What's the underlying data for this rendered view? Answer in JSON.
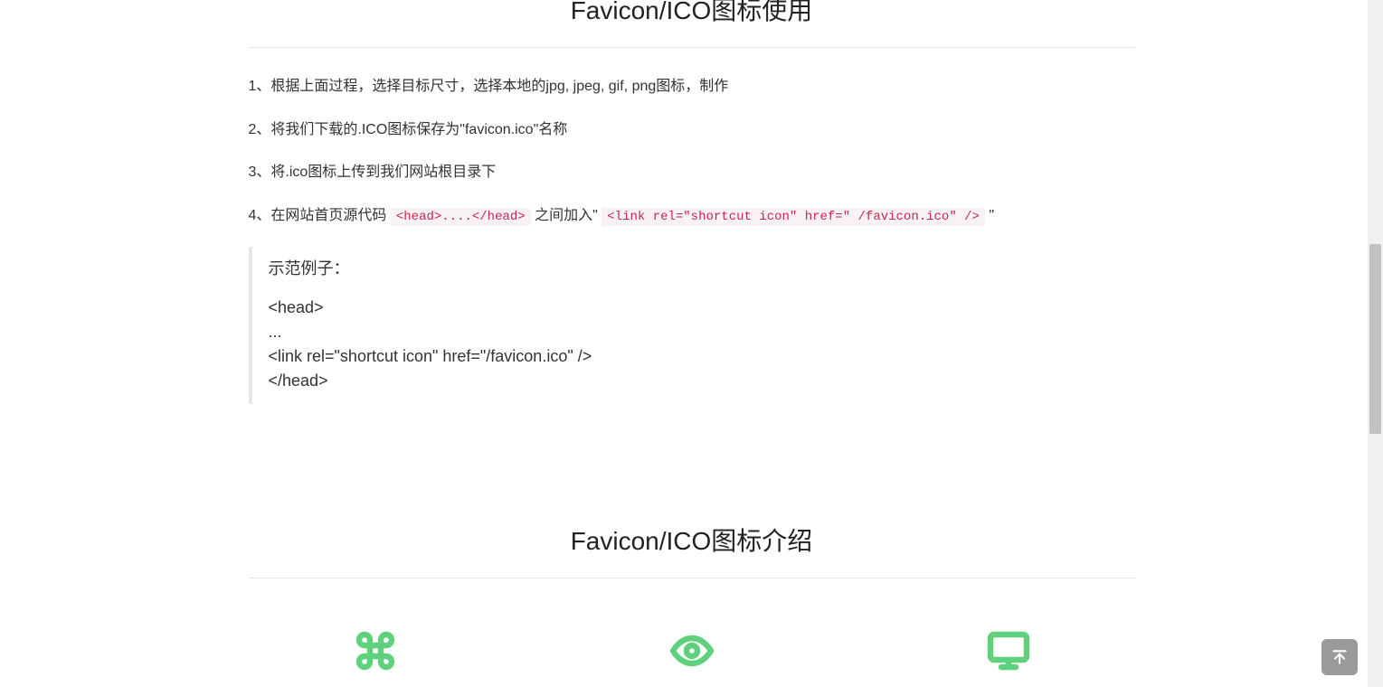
{
  "section1": {
    "title": "Favicon/ICO图标使用",
    "steps": {
      "s1": "1、根据上面过程，选择目标尺寸，选择本地的jpg, jpeg, gif, png图标，制作",
      "s2": "2、将我们下载的.ICO图标保存为\"favicon.ico\"名称",
      "s3": "3、将.ico图标上传到我们网站根目录下",
      "s4_prefix": "4、在网站首页源代码 ",
      "s4_code1": "<head>....</head>",
      "s4_mid": " 之间加入\" ",
      "s4_code2": "<link rel=\"shortcut icon\" href=\" /favicon.ico\" />",
      "s4_suffix": " \""
    },
    "example": {
      "label": "示范例子：",
      "code": "<head>\n...\n<link rel=\"shortcut icon\" href=\"/favicon.ico\" />\n</head>"
    }
  },
  "section2": {
    "title": "Favicon/ICO图标介绍"
  }
}
